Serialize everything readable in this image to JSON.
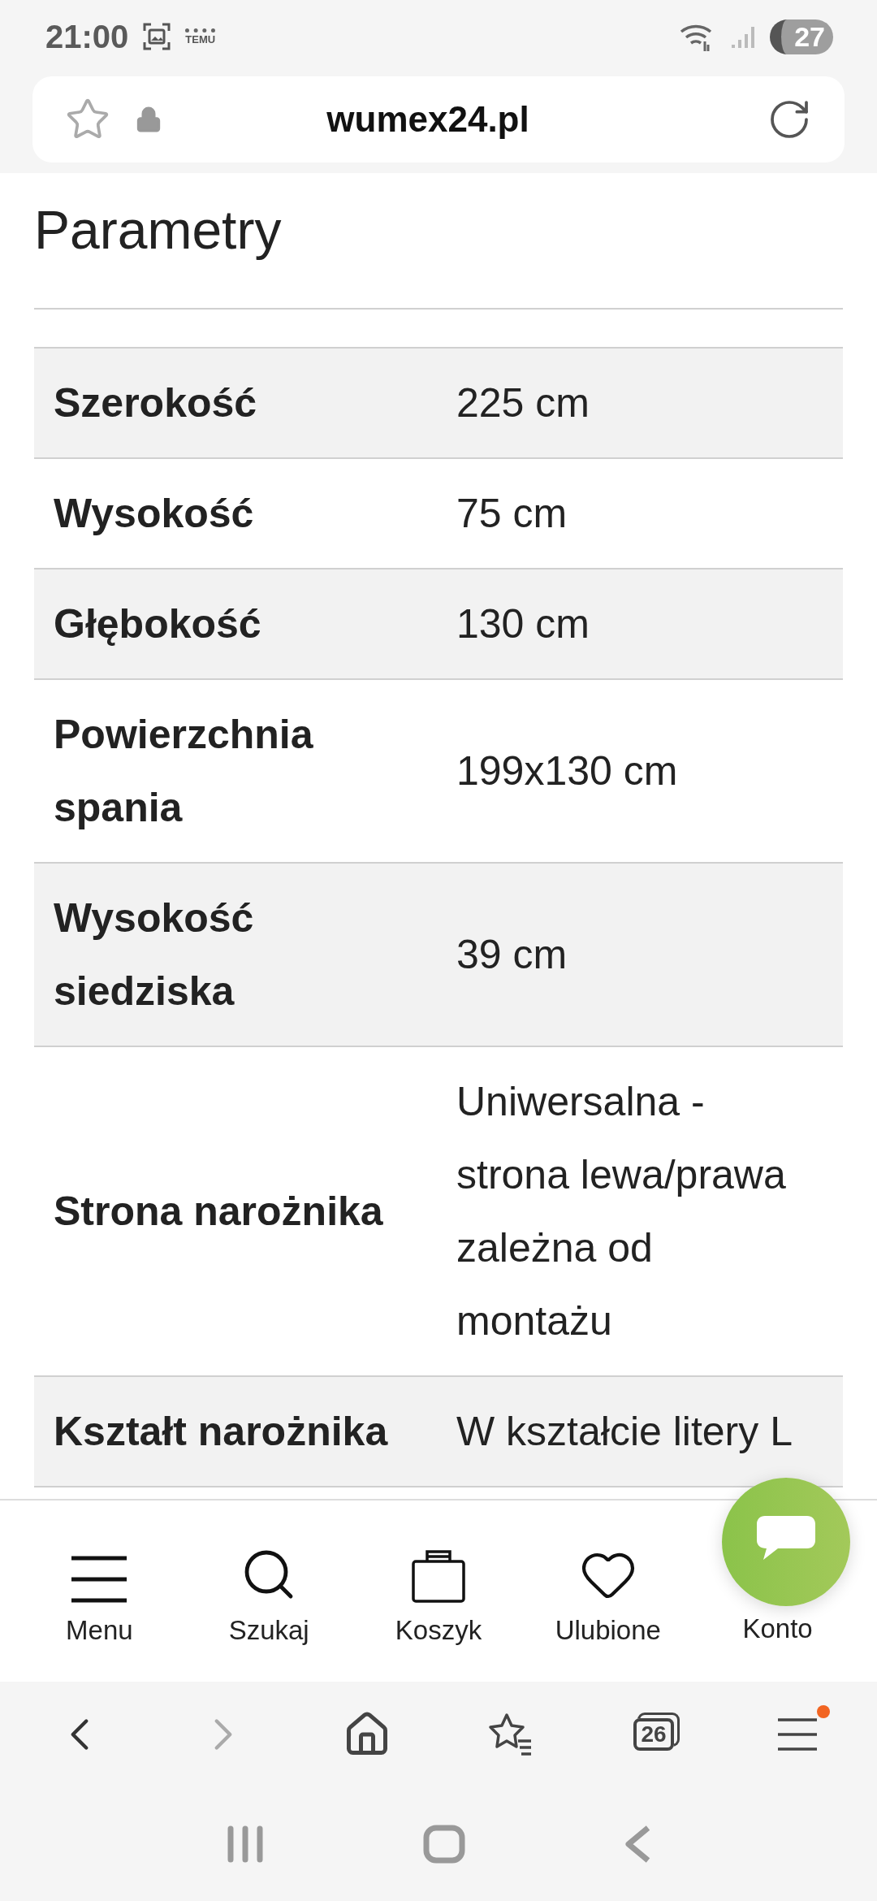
{
  "status_bar": {
    "time": "21:00",
    "notification_label": "TEMU",
    "battery": "27"
  },
  "address_bar": {
    "url": "wumex24.pl"
  },
  "section": {
    "title": "Parametry"
  },
  "table": {
    "rows": [
      {
        "label": "Szerokość",
        "value": "225 cm"
      },
      {
        "label": "Wysokość",
        "value": "75 cm"
      },
      {
        "label": "Głębokość",
        "value": "130 cm"
      },
      {
        "label": "Powierzchnia spania",
        "value": "199x130 cm"
      },
      {
        "label": "Wysokość siedziska",
        "value": "39 cm"
      },
      {
        "label": "Strona narożnika",
        "value": "Uniwersalna - strona lewa/prawa zależna od montażu"
      },
      {
        "label": "Kształt narożnika",
        "value": "W kształcie litery L"
      }
    ]
  },
  "bottom_nav": {
    "items": [
      {
        "kind": "menu",
        "label": "Menu"
      },
      {
        "kind": "search",
        "label": "Szukaj"
      },
      {
        "kind": "cart",
        "label": "Koszyk"
      },
      {
        "kind": "favorites",
        "label": "Ulubione"
      },
      {
        "kind": "account",
        "label": "Konto"
      }
    ]
  },
  "browser_toolbar": {
    "back": {
      "disabled": false
    },
    "forward": {
      "disabled": true
    },
    "tabs_count": "26",
    "menu_badge": true
  }
}
